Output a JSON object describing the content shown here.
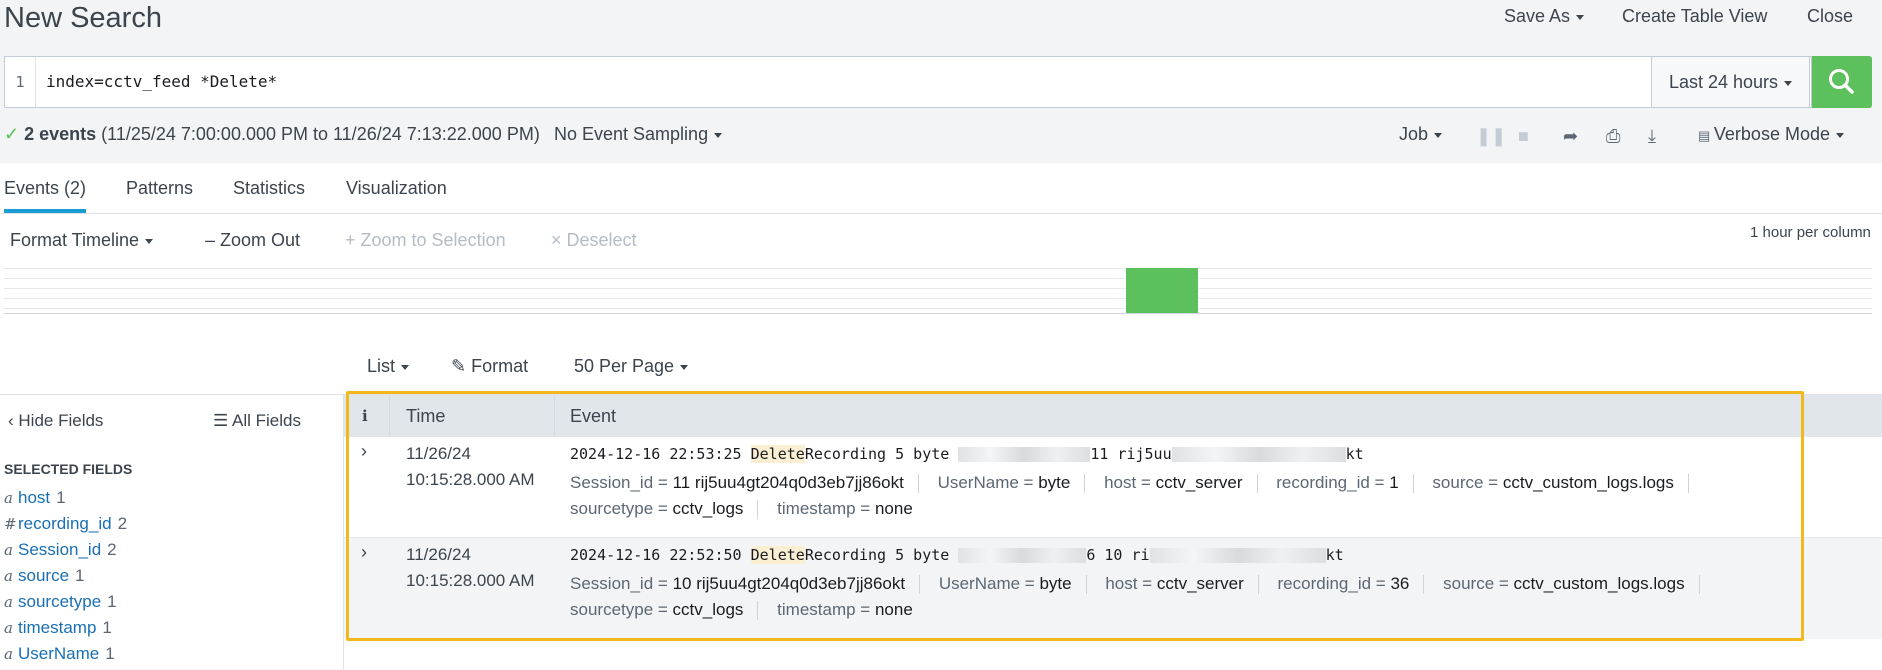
{
  "header": {
    "title": "New Search",
    "save_as": "Save As",
    "create_table_view": "Create Table View",
    "close": "Close"
  },
  "search": {
    "line_number": "1",
    "query": "index=cctv_feed *Delete*",
    "time_range": "Last 24 hours"
  },
  "status": {
    "event_count": "2 events",
    "range": "(11/25/24 7:00:00.000 PM to 11/26/24 7:13:22.000 PM)",
    "sampling": "No Event Sampling",
    "job": "Job",
    "mode": "Verbose Mode"
  },
  "tabs": [
    {
      "label": "Events (2)",
      "active": true
    },
    {
      "label": "Patterns"
    },
    {
      "label": "Statistics"
    },
    {
      "label": "Visualization"
    }
  ],
  "timeline": {
    "format": "Format Timeline",
    "zoom_out": "Zoom Out",
    "zoom_selection": "Zoom to Selection",
    "deselect": "Deselect",
    "scale": "1 hour per column"
  },
  "list_controls": {
    "list": "List",
    "format": "Format",
    "per_page": "50 Per Page"
  },
  "sidebar": {
    "hide_fields": "Hide Fields",
    "all_fields": "All Fields",
    "section_title": "SELECTED FIELDS",
    "fields": [
      {
        "type": "a",
        "name": "host",
        "count": "1"
      },
      {
        "type": "#",
        "name": "recording_id",
        "count": "2"
      },
      {
        "type": "a",
        "name": "Session_id",
        "count": "2"
      },
      {
        "type": "a",
        "name": "source",
        "count": "1"
      },
      {
        "type": "a",
        "name": "sourcetype",
        "count": "1"
      },
      {
        "type": "a",
        "name": "timestamp",
        "count": "1"
      },
      {
        "type": "a",
        "name": "UserName",
        "count": "1"
      }
    ]
  },
  "table": {
    "col_info": "i",
    "col_time": "Time",
    "col_event": "Event",
    "rows": [
      {
        "date": "11/26/24",
        "time": "10:15:28.000 AM",
        "raw_prefix": "2024-12-16 22:53:25 ",
        "raw_highlight": "Delete",
        "raw_mid": "Recording 5 byte ",
        "raw_visible_1": "11 rij5uu",
        "raw_suffix": "kt",
        "fields": {
          "session_id": "11 rij5uu4gt204q0d3eb7jj86okt",
          "username": "byte",
          "host": "cctv_server",
          "recording_id": "1",
          "source": "cctv_custom_logs.logs",
          "sourcetype": "cctv_logs",
          "timestamp": "none"
        }
      },
      {
        "date": "11/26/24",
        "time": "10:15:28.000 AM",
        "raw_prefix": "2024-12-16 22:52:50 ",
        "raw_highlight": "Delete",
        "raw_mid": "Recording 5 byte ",
        "raw_visible_1": "6 10 ri",
        "raw_suffix": "kt",
        "fields": {
          "session_id": "10 rij5uu4gt204q0d3eb7jj86okt",
          "username": "byte",
          "host": "cctv_server",
          "recording_id": "36",
          "source": "cctv_custom_logs.logs",
          "sourcetype": "cctv_logs",
          "timestamp": "none"
        }
      }
    ],
    "field_keys": {
      "session_id": "Session_id =",
      "username": "UserName =",
      "host": "host =",
      "recording_id": "recording_id =",
      "source": "source =",
      "sourcetype": "sourcetype =",
      "timestamp": "timestamp ="
    }
  },
  "colors": {
    "accent_green": "#5cc05c",
    "tab_underline": "#1a9cd5",
    "selection_border": "#f2b81c",
    "field_link": "#1a6fb3"
  }
}
